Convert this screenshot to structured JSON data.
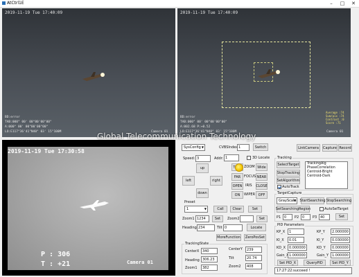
{
  "window": {
    "title": "AtCtrl1E",
    "controls": {
      "minimize": "–",
      "maximize": "□",
      "close": "✕"
    }
  },
  "camera_top_left": {
    "timestamp": "2019-11-19 Tue 17:40:09",
    "osd_lines": [
      "BD:error",
      "TAB:000° 00' 00\"00'00\"00\"",
      "A:000° 00' 00\"00'00\"00\"",
      "LO:E117°36'41\"N40° 03' 15\"100M"
    ],
    "camera_label": "Camera 01"
  },
  "camera_top_right": {
    "timestamp": "2019-11-19 Tue 17:40:09",
    "osd_lines": [
      "BD:error",
      "TAB:000° 00' 00\"00'00\"00\"",
      "A:002.68 P:+0.52",
      "LO:E117°36'41\"N40° 03' 15\"100M"
    ],
    "camera_label": "Camera 01",
    "track_info": [
      "Average :74",
      "Sum/pix :74",
      "Contrast :0",
      "Score :71"
    ]
  },
  "ir_camera": {
    "timestamp": "2019-11-19 Tue 17:30:58",
    "p_value": "P :  306",
    "t_value": "T : +21",
    "camera_label": "Camera 01"
  },
  "watermark": "Global Telecommunication Technology",
  "controls": {
    "sys_config": "SysConfig",
    "cvbs_index_label": "CVBSIndex",
    "cvbs_index_value": "1",
    "switch": "Switch",
    "link_camera": "LinkCamera",
    "capture": "Capture",
    "record": "Record",
    "speed_label": "Speed:",
    "speed_value": "3",
    "addr_label": "Addr:",
    "addr_value": "1",
    "locate_3d": "3D Locate",
    "up": "up",
    "left": "left",
    "right": "right",
    "down": "down",
    "tele": "TELE",
    "zoom": "ZOOM",
    "wide": "Wide",
    "far": "FAR",
    "focus": "FOCUS",
    "near": "NEAR",
    "open": "OPEN",
    "iris": "IRIS",
    "close": "CLOSE",
    "on": "ON",
    "wiper": "WIPER",
    "off": "OFF",
    "preset_label": "Preset",
    "preset_value": "1",
    "call": "Call",
    "clear": "Clear",
    "set": "Set",
    "zoom1_label": "Zoom1",
    "zoom1_value": "1234",
    "zoom2_label": "Zoom2",
    "zoom2_value": "",
    "heading_label": "Heading",
    "heading_value": "234",
    "tilt_label": "Tilt",
    "tilt_value": "0",
    "locate": "Locate",
    "more_function": "MoreFunction",
    "zero_pos_set": "ZeroPosSet"
  },
  "tracking": {
    "group_label": "Tracking",
    "select_target": "SelectTarget",
    "stop_tracking": "StopTracking",
    "set_algorithm": "SetAlgorithm",
    "auto_track": "AutoTrack",
    "algorithms": [
      "TrackingAlg",
      "PhaseCorrelation",
      "Centroid-Bright",
      "Centroid-Dark"
    ]
  },
  "target_capture": {
    "group_label": "TargetCapture",
    "mode": "GrayScale",
    "start_searching": "StartSearching",
    "stop_searching": "StopSearching",
    "set_searching_region": "SetSearchingRegion",
    "auto_sel_target": "AutoSelTarget",
    "p1_label": "P1",
    "p1_value": "0",
    "p2_label": "P2",
    "p2_value": "0",
    "p3_label": "P3",
    "p3_value": "40",
    "set": "Set"
  },
  "pid": {
    "group_label": "PID Parameters",
    "kp_x_label": "KP_X",
    "kp_x_value": "1",
    "kp_y_label": "KP_Y",
    "kp_y_value": "2.000000",
    "ki_x_label": "KI_X",
    "ki_x_value": "0.01",
    "ki_y_label": "KI_Y",
    "ki_y_value": "0.030000",
    "kd_x_label": "KD_X",
    "kd_x_value": "0.000000",
    "kd_y_label": "KD_Y",
    "kd_y_value": "0.000000",
    "gain_x_label": "Gain_X",
    "gain_x_value": "1.000000",
    "gain_y_label": "Gain_Y",
    "gain_y_value": "1.000000",
    "set_pid_x": "Set PID_X",
    "query_pid": "QueryPID",
    "set_pid_y": "Set PID_Y"
  },
  "tracking_state": {
    "group_label": "TrackingState",
    "center_x_label": "CenterX",
    "center_x_value": "340",
    "center_y_label": "CenterY",
    "center_y_value": "239",
    "heading_label": "Heading",
    "heading_value": "306.23",
    "tilt_label": "Tilt",
    "tilt_value": "20.74",
    "zoom1_label": "Zoom1",
    "zoom1_value": "382",
    "zoom2_label": "Zoom2",
    "zoom2_value": "408"
  },
  "status_text": "17:27:22:succeed !"
}
